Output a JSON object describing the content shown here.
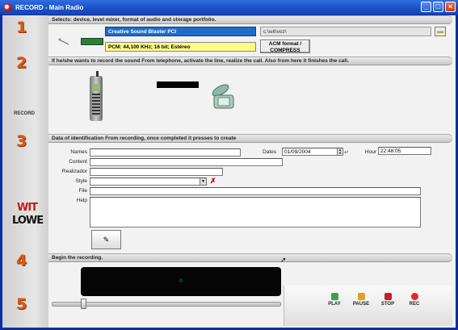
{
  "window": {
    "title": "RECORD - Main Radio"
  },
  "sidebar": {
    "steps": [
      "1",
      "2",
      "3",
      "4",
      "5"
    ],
    "record_label": "RECORD",
    "logo_top": "WIT",
    "logo_bottom": "LOWE"
  },
  "section1": {
    "header": "Selects: device, level mixer, format of audio and storage portfolio.",
    "device": "Creative Sound Blaster PCI",
    "format": "PCM: 44,100 KHz; 16 bit; Estéreo",
    "path": "c:\\wit\\voz\\",
    "acm_button": "ACM format / COMPRESS"
  },
  "section2": {
    "header": "If he/she wants to record the sound From telephone, activate the line, realize the call. Also from here it finishes the call."
  },
  "section3": {
    "header": "Data of identification From recording, once completed it presses to create",
    "labels": {
      "names": "Names",
      "content": "Content",
      "realizador": "Realizador",
      "style": "Style",
      "file": "File",
      "help": "Help",
      "dates": "Dates",
      "hour": "Hour"
    },
    "values": {
      "names": "",
      "content": "",
      "realizador": "",
      "style": "",
      "file": "",
      "help": "",
      "date": "01/09/2004",
      "hour": "22:48:05"
    }
  },
  "section4": {
    "header": "Begin the recording.",
    "counter": "0"
  },
  "controls": {
    "play": "PLAY",
    "pause": "PAUSE",
    "stop": "STOP",
    "rec": "REC"
  },
  "colors": {
    "device_bg": "#1e6cc8",
    "format_bg": "#fffc8a",
    "step_number": "#d85a18",
    "logo_red": "#cc1a1a"
  }
}
